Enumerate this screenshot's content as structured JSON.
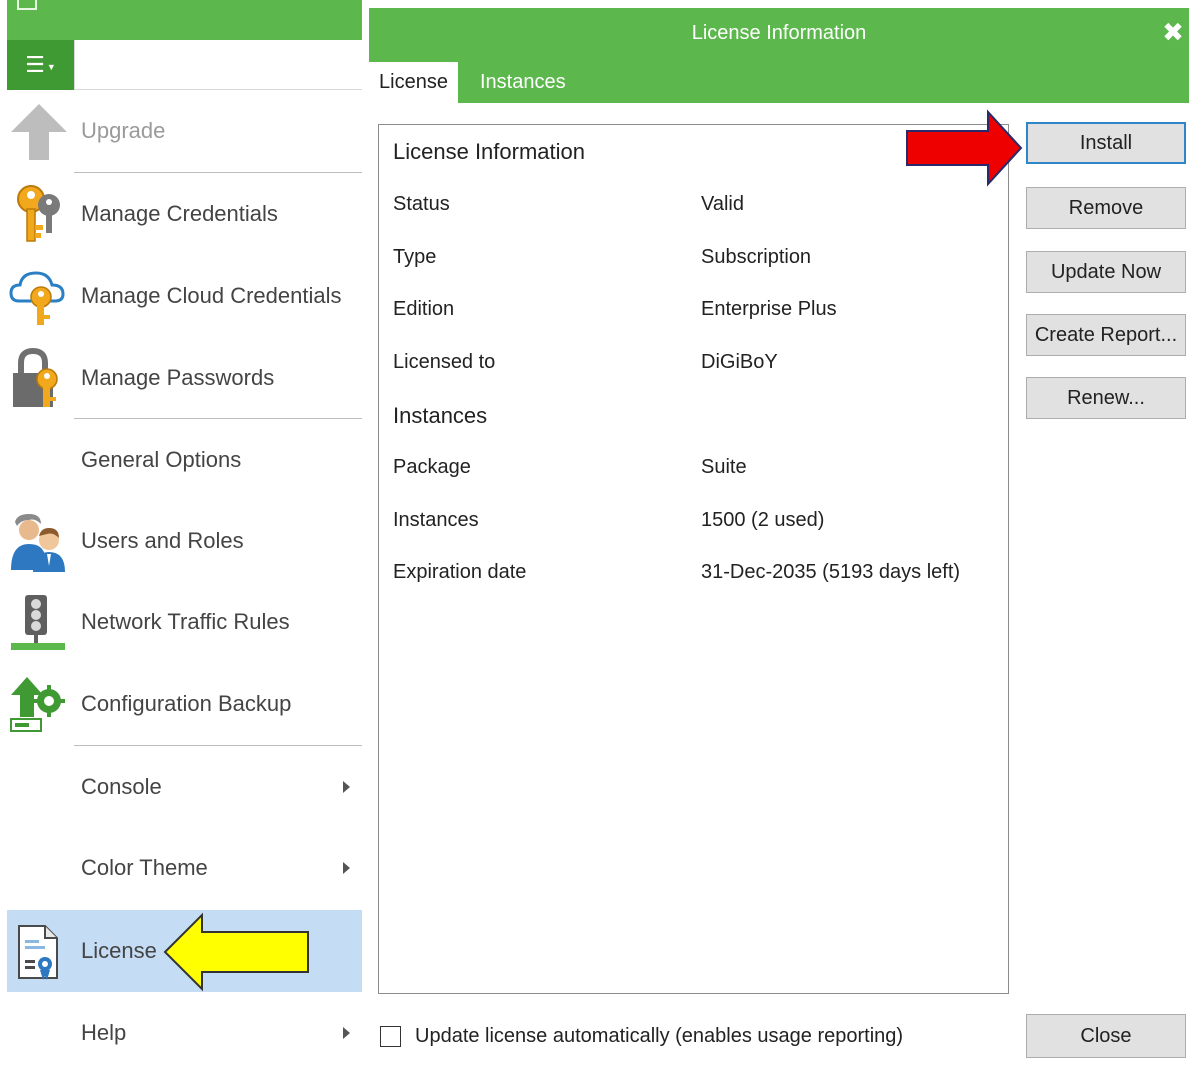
{
  "menu": {
    "items": [
      {
        "label": "Upgrade",
        "icon": "upgrade-arrow-icon",
        "disabled": true
      },
      {
        "label": "Manage Credentials",
        "icon": "key-icon"
      },
      {
        "label": "Manage Cloud Credentials",
        "icon": "cloud-key-icon"
      },
      {
        "label": "Manage Passwords",
        "icon": "lock-key-icon"
      },
      {
        "label": "General Options",
        "icon": ""
      },
      {
        "label": "Users and Roles",
        "icon": "users-icon"
      },
      {
        "label": "Network Traffic Rules",
        "icon": "traffic-light-icon"
      },
      {
        "label": "Configuration Backup",
        "icon": "config-backup-icon"
      },
      {
        "label": "Console",
        "submenu": true
      },
      {
        "label": "Color Theme",
        "submenu": true
      },
      {
        "label": "License",
        "icon": "license-certificate-icon",
        "selected": true
      },
      {
        "label": "Help",
        "submenu": true
      }
    ]
  },
  "dialog": {
    "title": "License Information",
    "tabs": [
      {
        "label": "License",
        "active": true
      },
      {
        "label": "Instances",
        "active": false
      }
    ],
    "info": {
      "heading": "License Information",
      "rows": [
        {
          "key": "Status",
          "value": "Valid"
        },
        {
          "key": "Type",
          "value": "Subscription"
        },
        {
          "key": "Edition",
          "value": "Enterprise Plus"
        },
        {
          "key": "Licensed to",
          "value": "DiGiBoY"
        }
      ],
      "instances_heading": "Instances",
      "instances_rows": [
        {
          "key": "Package",
          "value": "Suite"
        },
        {
          "key": "Instances",
          "value": "1500 (2 used)"
        },
        {
          "key": "Expiration date",
          "value": "31-Dec-2035 (5193 days left)"
        }
      ]
    },
    "buttons": {
      "install": "Install",
      "remove": "Remove",
      "update_now": "Update Now",
      "create_report": "Create Report...",
      "renew": "Renew...",
      "close": "Close"
    },
    "auto_update": {
      "label": "Update license automatically (enables usage reporting)",
      "checked": false
    }
  },
  "colors": {
    "brand_green": "#5cb84c",
    "menu_button_green": "#3f9a33",
    "selected_item": "#c5dcf5",
    "focus_blue": "#2f86c6",
    "annotation_yellow": "#ffff00",
    "annotation_red": "#ee0000"
  }
}
